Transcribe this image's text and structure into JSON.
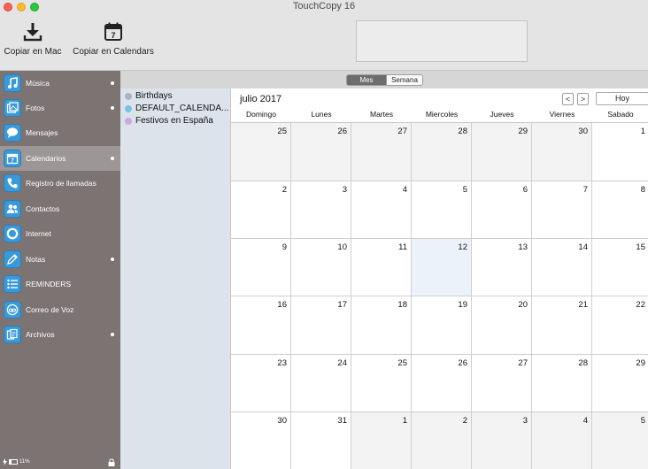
{
  "window": {
    "title": "TouchCopy 16"
  },
  "toolbar": {
    "copy_mac_label": "Copiar en Mac",
    "copy_calendars_label": "Copiar en Calendars",
    "calendar_icon_day": "7"
  },
  "view_toggle": {
    "month_label": "Mes",
    "week_label": "Semana",
    "selected": "Mes"
  },
  "sidebar": {
    "items": [
      {
        "label": "Música",
        "icon": "music-note-icon",
        "dot": true
      },
      {
        "label": "Fotos",
        "icon": "photos-icon",
        "dot": true
      },
      {
        "label": "Mensajes",
        "icon": "message-bubble-icon",
        "dot": false
      },
      {
        "label": "Calendarios",
        "icon": "calendar-icon",
        "dot": true,
        "selected": true
      },
      {
        "label": "Registro de llamadas",
        "icon": "phone-icon",
        "dot": false
      },
      {
        "label": "Contactos",
        "icon": "contacts-icon",
        "dot": false
      },
      {
        "label": "Internet",
        "icon": "globe-ring-icon",
        "dot": false
      },
      {
        "label": "Notas",
        "icon": "pencil-icon",
        "dot": true
      },
      {
        "label": "REMINDERS",
        "icon": "list-icon",
        "dot": false
      },
      {
        "label": "Correo de Voz",
        "icon": "voicemail-icon",
        "dot": false
      },
      {
        "label": "Archivos",
        "icon": "files-icon",
        "dot": true
      }
    ],
    "footer": {
      "battery_percent": "11%"
    }
  },
  "calendars": [
    {
      "name": "Birthdays",
      "color": "#a9b4c6"
    },
    {
      "name": "DEFAULT_CALENDA...",
      "color": "#79c3e8"
    },
    {
      "name": "Festivos en España",
      "color": "#cfa8e2"
    }
  ],
  "calendar": {
    "month_title": "julio 2017",
    "prev_label": "<",
    "next_label": ">",
    "today_label": "Hoy",
    "weekdays": [
      "Domingo",
      "Lunes",
      "Martes",
      "Miercoles",
      "Jueves",
      "Viernes",
      "Sabado"
    ],
    "weeks": [
      [
        25,
        26,
        27,
        28,
        29,
        30,
        1
      ],
      [
        2,
        3,
        4,
        5,
        6,
        7,
        8
      ],
      [
        9,
        10,
        11,
        12,
        13,
        14,
        15
      ],
      [
        16,
        17,
        18,
        19,
        20,
        21,
        22
      ],
      [
        23,
        24,
        25,
        26,
        27,
        28,
        29
      ],
      [
        30,
        31,
        1,
        2,
        3,
        4,
        5
      ]
    ],
    "highlighted_day": 12
  },
  "colors": {
    "sidebar_bg": "#7b7473",
    "sidebar_selected": "#9c9697",
    "calendar_list_bg": "#dde3ea",
    "today_cell": "#ecf2fa",
    "outside_month_cell": "#f3f3f3"
  }
}
